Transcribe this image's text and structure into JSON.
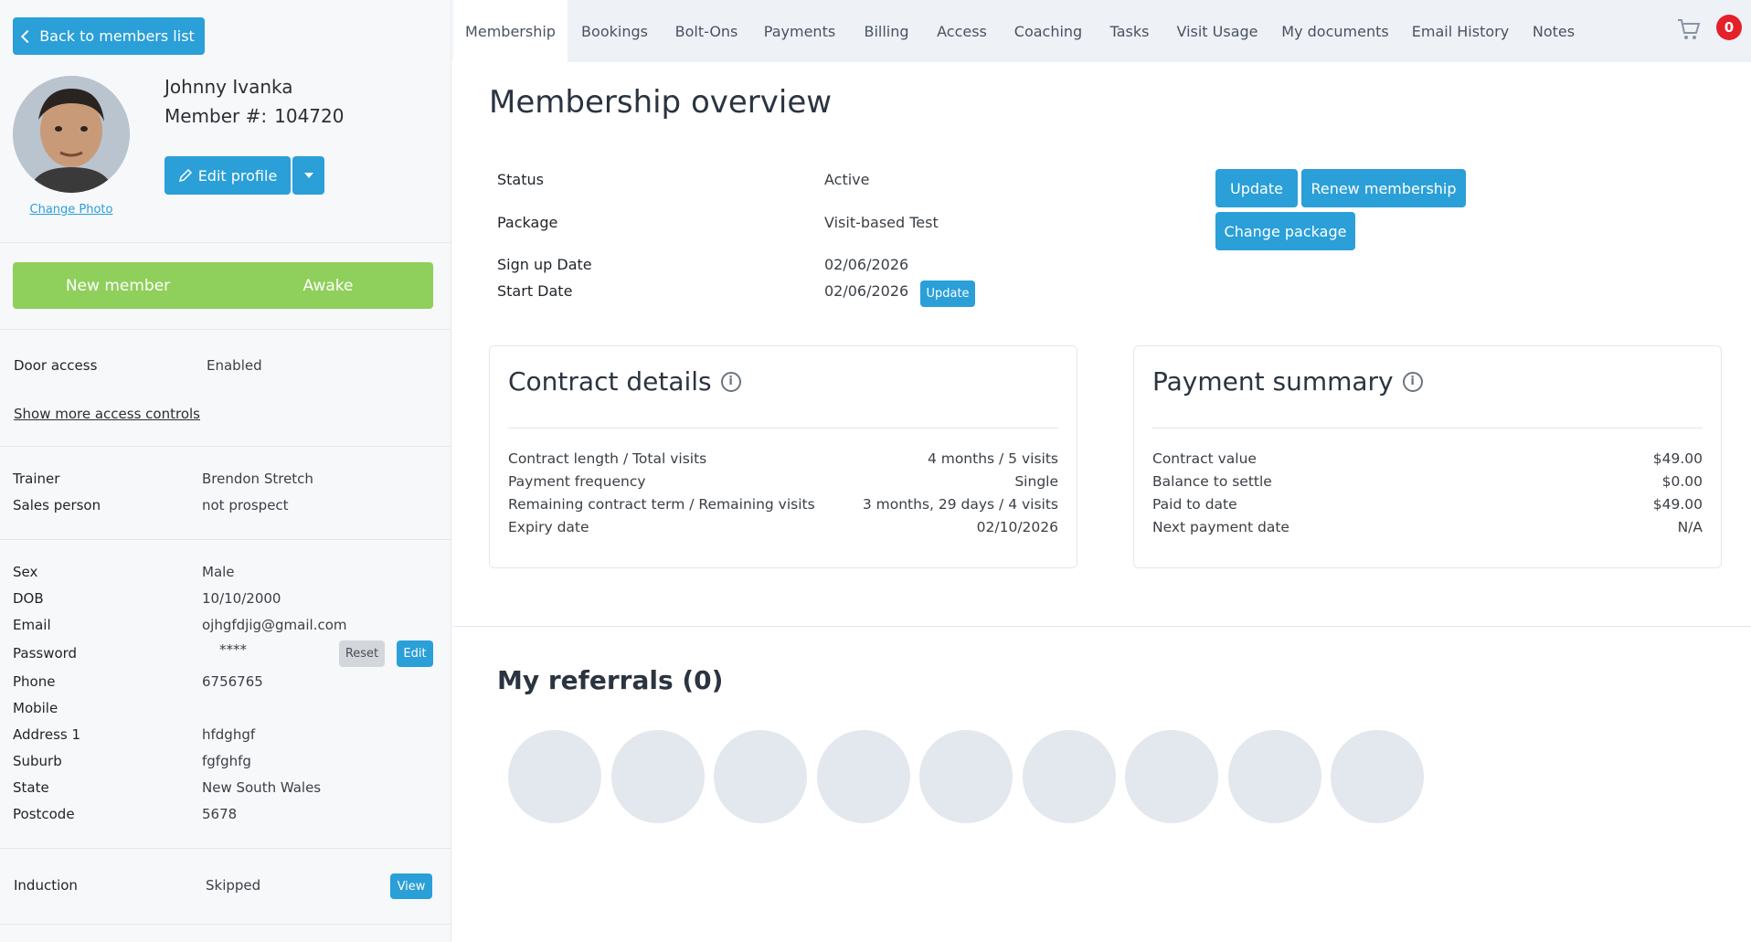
{
  "sidebar": {
    "back_label": "Back to members list",
    "member_name": "Johnny Ivanka",
    "member_number_label": "Member #:",
    "member_number": "104720",
    "change_photo": "Change Photo",
    "edit_profile": "Edit profile",
    "status_left": "New member",
    "status_right": "Awake",
    "door_access_label": "Door access",
    "door_access_value": "Enabled",
    "show_more_access": "Show more access controls",
    "trainer_label": "Trainer",
    "trainer_value": "Brendon Stretch",
    "sales_label": "Sales person",
    "sales_value": "not prospect",
    "details": {
      "sex_label": "Sex",
      "sex_value": "Male",
      "dob_label": "DOB",
      "dob_value": "10/10/2000",
      "email_label": "Email",
      "email_value": "ojhgfdjig@gmail.com",
      "password_label": "Password",
      "password_value": "****",
      "reset_label": "Reset",
      "edit_label": "Edit",
      "phone_label": "Phone",
      "phone_value": "6756765",
      "mobile_label": "Mobile",
      "address_label": "Address 1",
      "address_value": "hfdghgf",
      "suburb_label": "Suburb",
      "suburb_value": "fgfghfg",
      "state_label": "State",
      "state_value": "New South Wales",
      "postcode_label": "Postcode",
      "postcode_value": "5678"
    },
    "induction_label": "Induction",
    "induction_value": "Skipped",
    "view_label": "View"
  },
  "tabs": [
    "Membership",
    "Bookings",
    "Bolt-Ons",
    "Payments",
    "Billing",
    "Access",
    "Coaching",
    "Tasks",
    "Visit Usage",
    "My documents",
    "Email History",
    "Notes"
  ],
  "cart_count": "0",
  "overview": {
    "title": "Membership overview",
    "status_label": "Status",
    "status_value": "Active",
    "package_label": "Package",
    "package_value": "Visit-based Test",
    "signup_label": "Sign up Date",
    "signup_value": "02/06/2026",
    "start_label": "Start Date",
    "start_value": "02/06/2026",
    "start_update": "Update",
    "update_btn": "Update",
    "renew_btn": "Renew membership",
    "change_pkg_btn": "Change package"
  },
  "contract": {
    "title": "Contract details",
    "rows": [
      {
        "label": "Contract length / Total visits",
        "value": "4 months / 5 visits"
      },
      {
        "label": "Payment frequency",
        "value": "Single"
      },
      {
        "label": "Remaining contract term / Remaining visits",
        "value": "3 months, 29 days / 4 visits"
      },
      {
        "label": "Expiry date",
        "value": "02/10/2026"
      }
    ]
  },
  "payment": {
    "title": "Payment summary",
    "rows": [
      {
        "label": "Contract value",
        "value": "$49.00"
      },
      {
        "label": "Balance to settle",
        "value": "$0.00"
      },
      {
        "label": "Paid to date",
        "value": "$49.00"
      },
      {
        "label": "Next payment date",
        "value": "N/A"
      }
    ]
  },
  "referrals": {
    "title": "My referrals (0)"
  }
}
